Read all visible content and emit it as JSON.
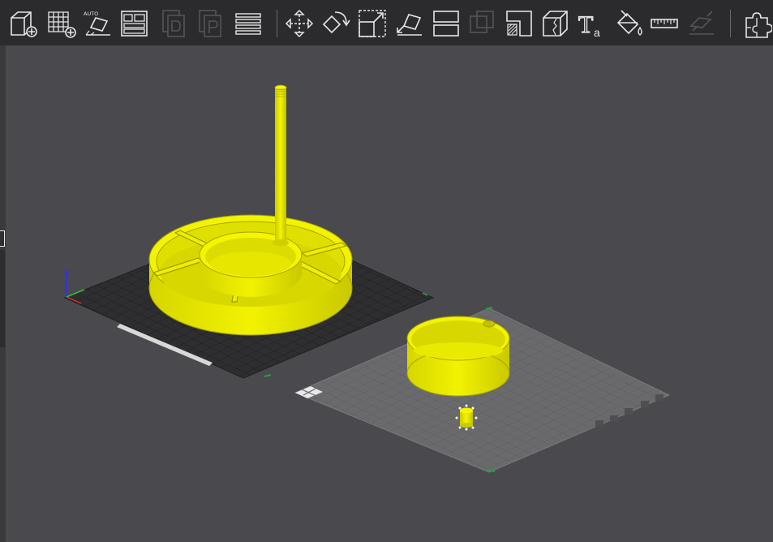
{
  "toolbar": {
    "buttons": [
      {
        "name": "add-object-button",
        "icon": "cube-plus-icon",
        "enabled": true
      },
      {
        "name": "add-grid-button",
        "icon": "grid-plus-icon",
        "enabled": true
      },
      {
        "name": "auto-orient-button",
        "icon": "auto-orient-icon",
        "label": "AUTO",
        "enabled": true
      },
      {
        "name": "arrange-button",
        "icon": "layout-icon",
        "enabled": true
      },
      {
        "name": "copy-button",
        "icon": "copy-icon",
        "enabled": false
      },
      {
        "name": "paste-button",
        "icon": "paste-icon",
        "enabled": false
      },
      {
        "name": "layers-button",
        "icon": "layers-icon",
        "enabled": true
      },
      {
        "name": "move-button",
        "icon": "move-arrows-icon",
        "enabled": true
      },
      {
        "name": "rotate-button",
        "icon": "rotate-icon",
        "enabled": true
      },
      {
        "name": "scale-button",
        "icon": "scale-icon",
        "enabled": true
      },
      {
        "name": "place-on-face-button",
        "icon": "lay-flat-icon",
        "enabled": true
      },
      {
        "name": "cut-button",
        "icon": "cut-icon",
        "enabled": true
      },
      {
        "name": "boolean-button",
        "icon": "boolean-icon",
        "enabled": false
      },
      {
        "name": "support-paint-button",
        "icon": "support-paint-icon",
        "enabled": true
      },
      {
        "name": "seam-button",
        "icon": "seam-cube-icon",
        "enabled": true
      },
      {
        "name": "text-button",
        "icon": "text-tool-icon",
        "label": "T",
        "sublabel": "a",
        "enabled": true
      },
      {
        "name": "color-paint-button",
        "icon": "paint-bucket-icon",
        "enabled": true
      },
      {
        "name": "measure-button",
        "icon": "ruler-icon",
        "enabled": true
      },
      {
        "name": "assembly-button",
        "icon": "assembly-icon",
        "enabled": false
      },
      {
        "name": "split-parts-button",
        "icon": "puzzle-icon",
        "enabled": true
      }
    ]
  },
  "viewport": {
    "background": "#4a4a4e",
    "model_color": "#e8e800",
    "bed1_color": "#2e2e30",
    "bed2_color": "#6a6a6d",
    "objects": [
      "tray-with-spindle",
      "cylinder-cup",
      "small-peg"
    ]
  }
}
